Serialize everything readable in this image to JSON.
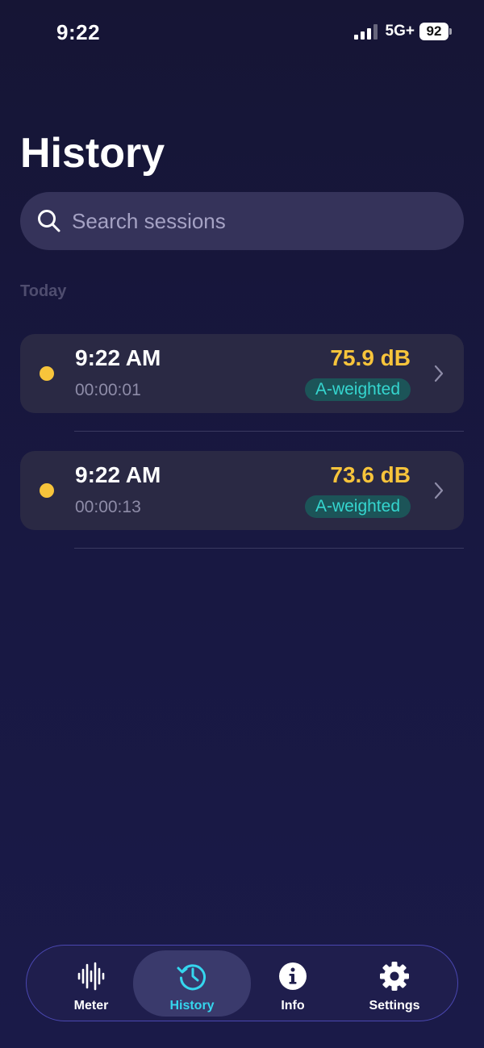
{
  "status": {
    "time": "9:22",
    "network": "5G+",
    "battery": "92"
  },
  "header": {
    "title": "History"
  },
  "search": {
    "placeholder": "Search sessions",
    "value": ""
  },
  "section": {
    "label": "Today"
  },
  "sessions": [
    {
      "time": "9:22 AM",
      "duration": "00:00:01",
      "level": "75.9 dB",
      "weighting": "A-weighted"
    },
    {
      "time": "9:22 AM",
      "duration": "00:00:13",
      "level": "73.6 dB",
      "weighting": "A-weighted"
    }
  ],
  "tabs": [
    {
      "label": "Meter",
      "icon": "waveform-icon",
      "active": false
    },
    {
      "label": "History",
      "icon": "history-clock-icon",
      "active": true
    },
    {
      "label": "Info",
      "icon": "info-icon",
      "active": false
    },
    {
      "label": "Settings",
      "icon": "gear-icon",
      "active": false
    }
  ],
  "colors": {
    "background": "#161535",
    "accent_level": "#f7c43b",
    "accent_active_tab": "#35d6ee",
    "badge_text": "#35d6cf",
    "badge_bg": "#1c5458"
  }
}
